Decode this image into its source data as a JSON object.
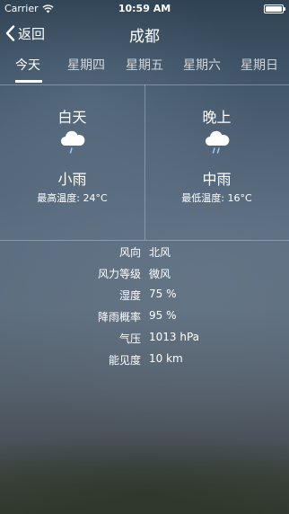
{
  "status": {
    "carrier": "Carrier",
    "time": "10:59 AM",
    "wifi_icon": "wifi-icon",
    "battery_icon": "battery-icon"
  },
  "nav": {
    "back_label": "返回",
    "title": "成都"
  },
  "tabs": [
    {
      "label": "今天",
      "active": true
    },
    {
      "label": "星期四",
      "active": false
    },
    {
      "label": "星期五",
      "active": false
    },
    {
      "label": "星期六",
      "active": false
    },
    {
      "label": "星期日",
      "active": false
    }
  ],
  "day": {
    "period": "白天",
    "icon": "light-rain-cloud-icon",
    "condition": "小雨",
    "temp_text": "最高温度: 24°C"
  },
  "night": {
    "period": "晚上",
    "icon": "rain-cloud-icon",
    "condition": "中雨",
    "temp_text": "最低温度: 16°C"
  },
  "details": [
    {
      "label": "风向",
      "value": "北风"
    },
    {
      "label": "风力等级",
      "value": "微风"
    },
    {
      "label": "湿度",
      "value": "75 %"
    },
    {
      "label": "降雨概率",
      "value": "95 %"
    },
    {
      "label": "气压",
      "value": "1013 hPa"
    },
    {
      "label": "能见度",
      "value": "10 km"
    }
  ]
}
